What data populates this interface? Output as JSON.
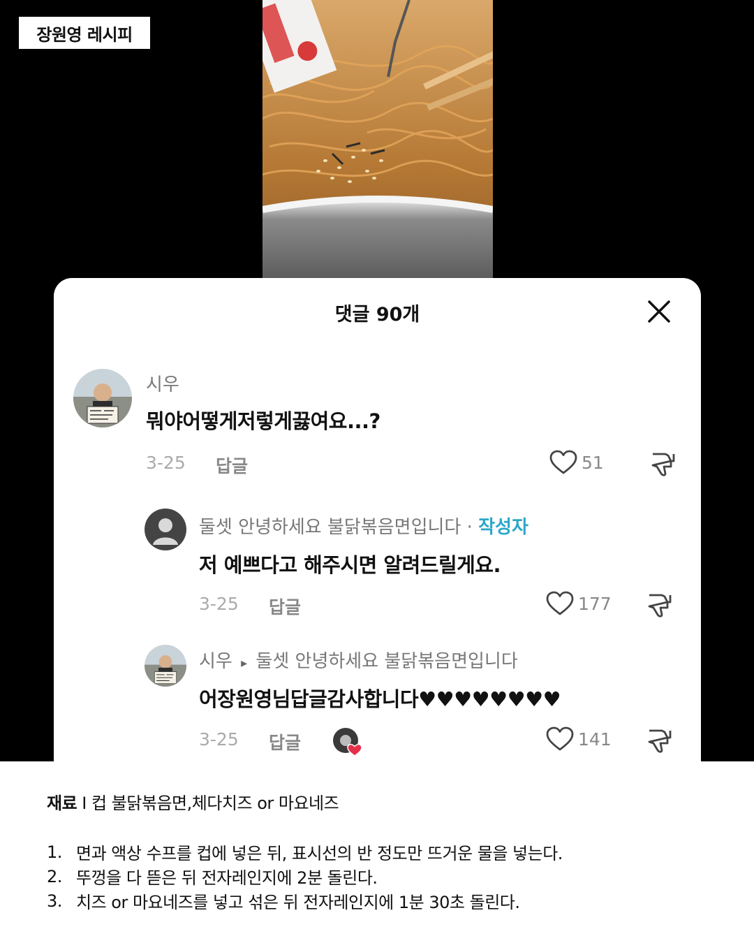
{
  "tag": "장원영 레시피",
  "sheet": {
    "title": "댓글 90개"
  },
  "comments": [
    {
      "user": "시우",
      "text": "뭐야어떻게저렇게끓여요...?",
      "date": "3-25",
      "reply_label": "답글",
      "likes": "51",
      "avatar_icon": "profile-photo"
    },
    {
      "user": "둘셋 안녕하세요 불닭볶음면입니다",
      "separator": " · ",
      "author_badge": "작성자",
      "text": "저 예쁘다고 해주시면 알려드릴게요.",
      "date": "3-25",
      "reply_label": "답글",
      "likes": "177",
      "avatar_icon": "default-user-icon"
    },
    {
      "user": "시우",
      "reply_arrow": "▸",
      "reply_to": "둘셋 안녕하세요 불닭볶음면입니다",
      "text": "어장원영님답글감사합니다♥♥♥♥♥♥♥♥",
      "date": "3-25",
      "reply_label": "답글",
      "likes": "141",
      "avatar_icon": "profile-photo"
    }
  ],
  "recipe": {
    "ingredients_label": "재료",
    "ingredients_sep": " I ",
    "ingredients": "컵 불닭볶음면,체다치즈 or 마요네즈",
    "steps": [
      {
        "num": "1.",
        "text": "면과 액상 수프를 컵에 넣은 뒤, 표시선의 반 정도만 뜨거운 물을 넣는다."
      },
      {
        "num": "2.",
        "text": "뚜껑을 다 뜯은 뒤 전자레인지에 2분 돌린다."
      },
      {
        "num": "3.",
        "text": "치즈 or 마요네즈를 넣고 섞은 뒤 전자레인지에 1분 30초 돌린다."
      }
    ]
  },
  "colors": {
    "author_badge": "#2aa7c9",
    "background_top": "#000000",
    "like_heart_red": "#e5304a"
  }
}
